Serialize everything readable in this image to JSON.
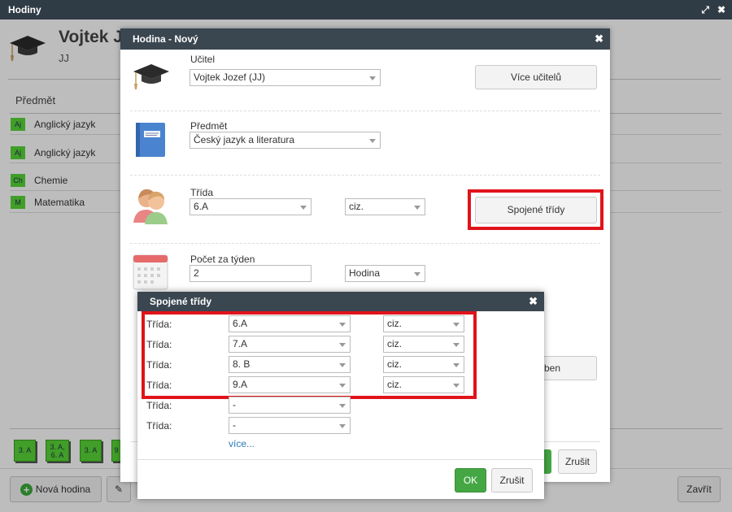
{
  "back_window": {
    "title": "Hodiny",
    "teacher_name": "Vojtek J",
    "teacher_abbr": "JJ",
    "column_header": "Předmět",
    "subjects": [
      {
        "badge": "Aj",
        "label": "Anglický jazyk"
      },
      {
        "badge": "Aj",
        "label": "Anglický jazyk"
      },
      {
        "badge": "Ch",
        "label": "Chemie"
      },
      {
        "badge": "M",
        "label": "Matematika"
      }
    ],
    "lesson_chips": [
      "3. A",
      "3. A, 6. A",
      "3. A",
      "9"
    ],
    "new_lesson_button": "Nová hodina",
    "close_button": "Zavřít",
    "colors": {
      "titlebar": "#2f3b45",
      "badge_green": "#58d538"
    }
  },
  "lesson_dialog": {
    "title": "Hodina - Nový",
    "teacher": {
      "label": "Učitel",
      "value": "Vojtek Jozef (JJ)",
      "more_teachers_button": "Více učitelů"
    },
    "subject": {
      "label": "Předmět",
      "value": "Český jazyk a literatura"
    },
    "class": {
      "label": "Třída",
      "value": "6.A",
      "group": "ciz.",
      "joined_classes_button": "Spojené třídy"
    },
    "weekly_count": {
      "label": "Počet za týden",
      "value": "2",
      "unit": "Hodina"
    },
    "partial_button_text": "eben",
    "cancel_button": "Zrušit"
  },
  "joined_dialog": {
    "title": "Spojené třídy",
    "rows": [
      {
        "label": "Třída:",
        "class": "6.A",
        "group": "ciz."
      },
      {
        "label": "Třída:",
        "class": "7.A",
        "group": "ciz."
      },
      {
        "label": "Třída:",
        "class": "8. B",
        "group": "ciz."
      },
      {
        "label": "Třída:",
        "class": "9.A",
        "group": "ciz."
      },
      {
        "label": "Třída:",
        "class": "-",
        "group": ""
      },
      {
        "label": "Třída:",
        "class": "-",
        "group": ""
      }
    ],
    "more_link": "více...",
    "ok_button": "OK",
    "cancel_button": "Zrušit",
    "colors": {
      "ok_green": "#44a744",
      "highlight_red": "#e0131b",
      "link_blue": "#2a7ab8"
    }
  }
}
